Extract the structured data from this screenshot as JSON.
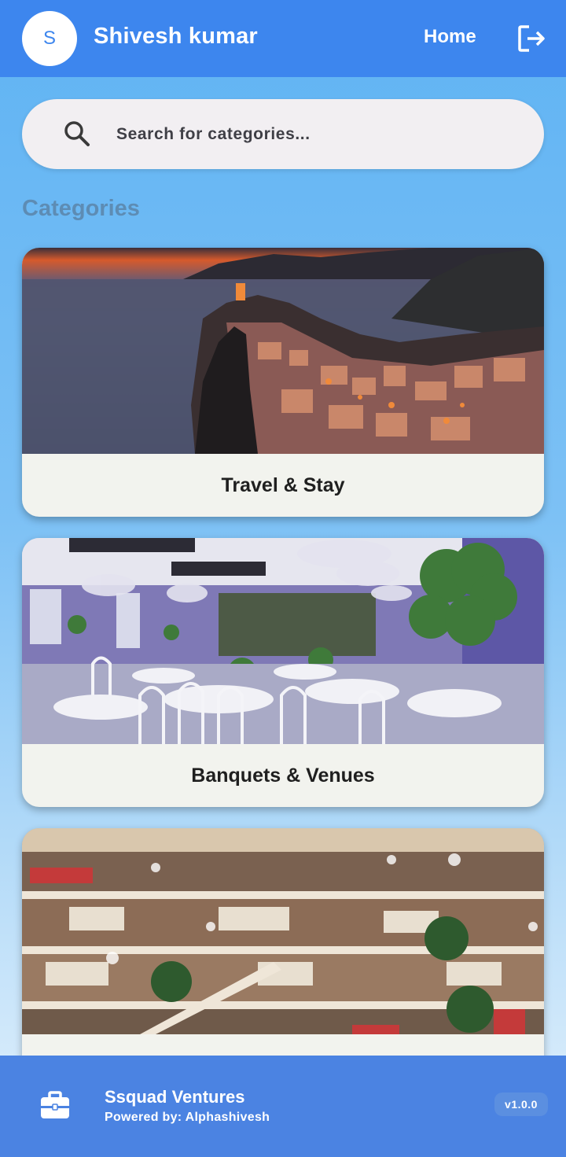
{
  "header": {
    "avatar_initial": "S",
    "user_name": "Shivesh kumar",
    "home_label": "Home",
    "logout_icon": "logout-icon",
    "color": "#3d86ee"
  },
  "search": {
    "placeholder": "Search for categories...",
    "value": "",
    "icon": "search-icon"
  },
  "section": {
    "title": "Categories"
  },
  "categories": [
    {
      "label": "Travel & Stay",
      "image": "coastal-village-at-dusk"
    },
    {
      "label": "Banquets & Venues",
      "image": "decorated-banquet-hall"
    },
    {
      "label": "",
      "image": "shopping-mall-interior"
    }
  ],
  "footer": {
    "icon": "briefcase-icon",
    "company": "Ssquad Ventures",
    "powered_by": "Powered by: Alphashivesh",
    "version": "v1.0.0",
    "color": "#4b83e2"
  }
}
